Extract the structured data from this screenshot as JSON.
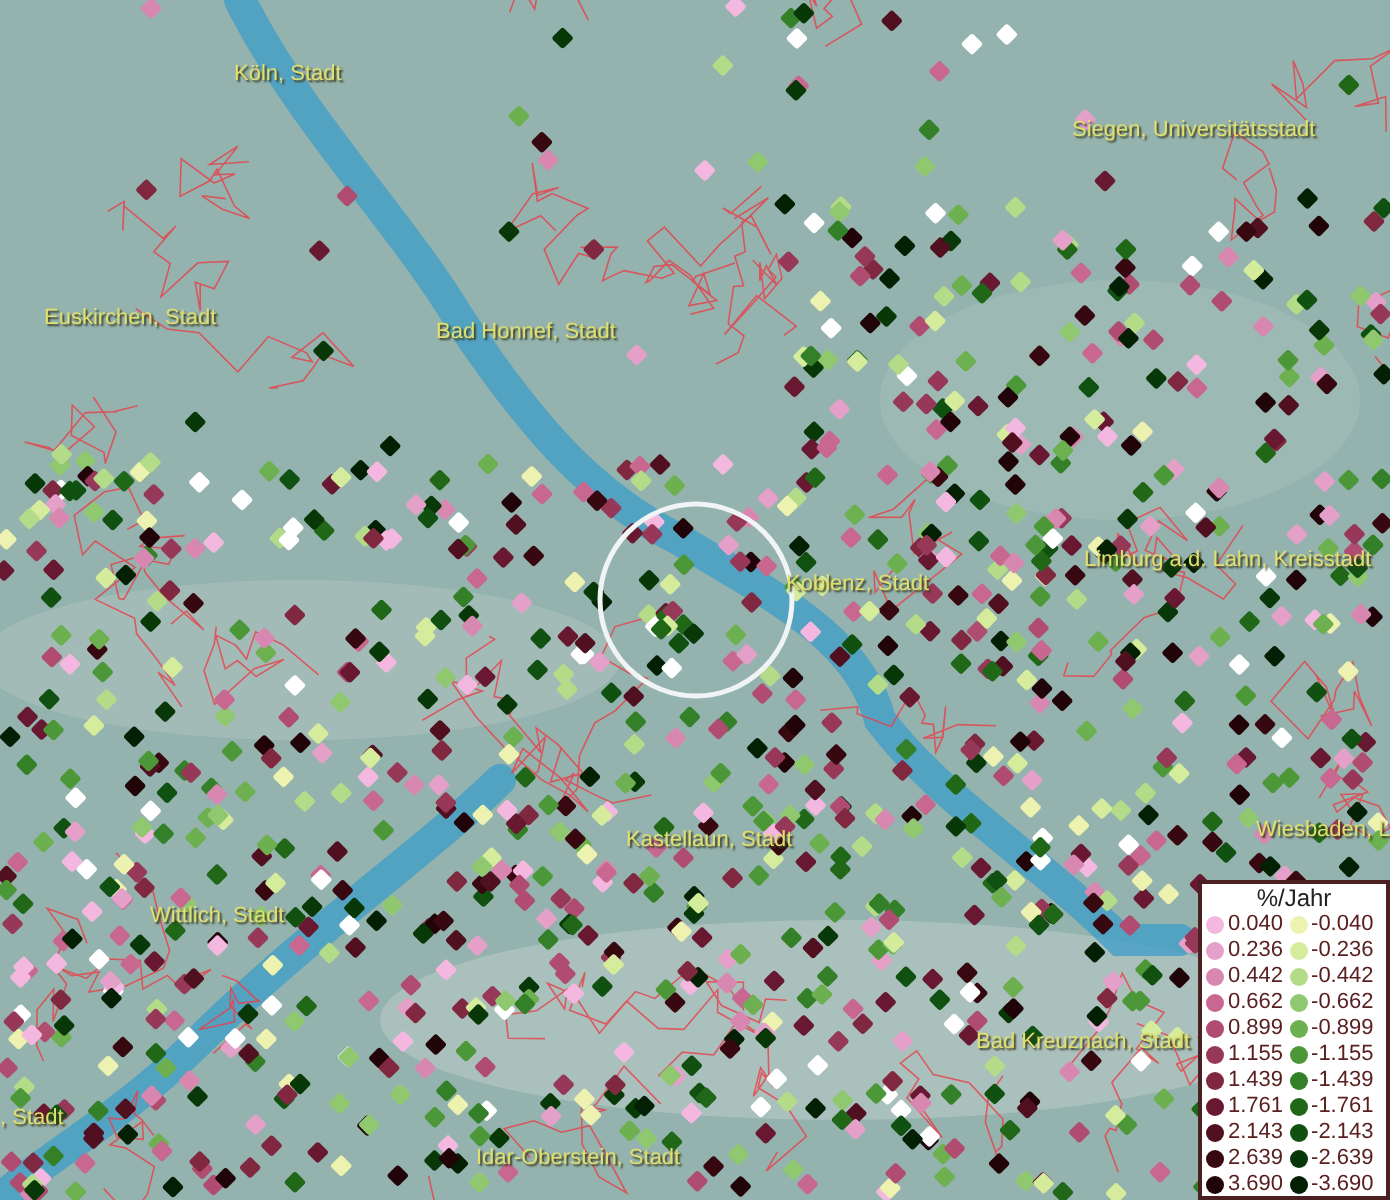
{
  "map": {
    "place_labels": [
      "Köln, Stadt",
      "Siegen, Universitätsstadt",
      "Euskirchen, Stadt",
      "Bad Honnef, Stadt",
      "Koblenz, Stadt",
      "Limburg a.d. Lahn, Kreisstadt",
      "Wiesbaden, L",
      "Kastellaun, Stadt",
      "Wittlich, Stadt",
      "Bad Kreuznach, Stadt",
      ", Stadt",
      "Idar-Oberstein, Stadt"
    ]
  },
  "legend": {
    "title": "%/Jahr",
    "positive": [
      {
        "label": "0.040",
        "color": "#f4b8e0"
      },
      {
        "label": "0.236",
        "color": "#e4a0c8"
      },
      {
        "label": "0.442",
        "color": "#d888b0"
      },
      {
        "label": "0.662",
        "color": "#c86890"
      },
      {
        "label": "0.899",
        "color": "#b04c70"
      },
      {
        "label": "1.155",
        "color": "#983858"
      },
      {
        "label": "1.439",
        "color": "#802840"
      },
      {
        "label": "1.761",
        "color": "#681830"
      },
      {
        "label": "2.143",
        "color": "#501020"
      },
      {
        "label": "2.639",
        "color": "#380810"
      },
      {
        "label": "3.690",
        "color": "#200408"
      }
    ],
    "negative": [
      {
        "label": "-0.040",
        "color": "#eef2b0"
      },
      {
        "label": "-0.236",
        "color": "#d4ec9c"
      },
      {
        "label": "-0.442",
        "color": "#b4dc88"
      },
      {
        "label": "-0.662",
        "color": "#90c870"
      },
      {
        "label": "-0.899",
        "color": "#6cb050"
      },
      {
        "label": "-1.155",
        "color": "#4c9838"
      },
      {
        "label": "-1.439",
        "color": "#348028"
      },
      {
        "label": "-1.761",
        "color": "#206818"
      },
      {
        "label": "-2.143",
        "color": "#105010"
      },
      {
        "label": "-2.639",
        "color": "#083808"
      },
      {
        "label": "-3.690",
        "color": "#042004"
      }
    ]
  }
}
